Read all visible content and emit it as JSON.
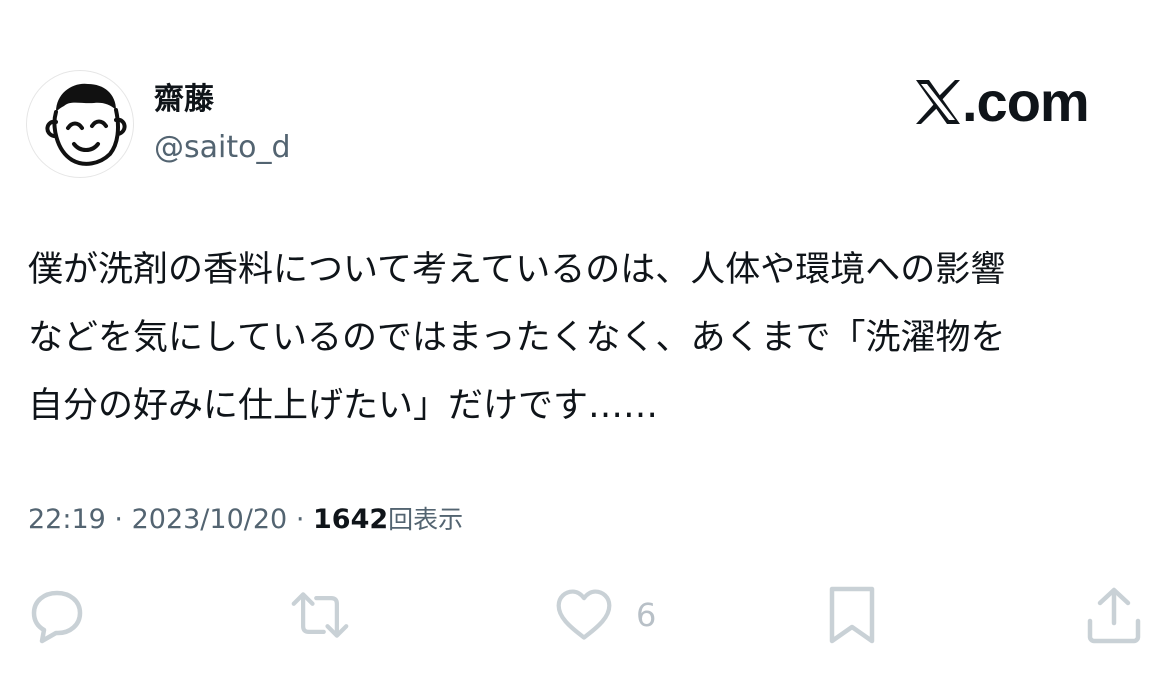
{
  "author": {
    "display_name": "齋藤",
    "handle": "@saito_d",
    "avatar_icon": "smiling-face-drawing-icon"
  },
  "brand": {
    "logo_icon": "x-logo-icon",
    "text": ".com"
  },
  "tweet": {
    "lines": [
      "僕が洗剤の香料について考えているのは、人体や環境への影響",
      "などを気にしているのではまったくなく、あくまで「洗濯物を",
      "自分の好みに仕上げたい」だけです……"
    ]
  },
  "meta": {
    "time": "22:19",
    "separator": "·",
    "date": "2023/10/20",
    "views_count": "1642",
    "views_label": "回表示"
  },
  "actions": {
    "reply_icon": "reply-icon",
    "retweet_icon": "retweet-icon",
    "like_icon": "heart-icon",
    "like_count": "6",
    "bookmark_icon": "bookmark-icon",
    "share_icon": "share-icon",
    "icon_color": "#c9d1d6"
  }
}
